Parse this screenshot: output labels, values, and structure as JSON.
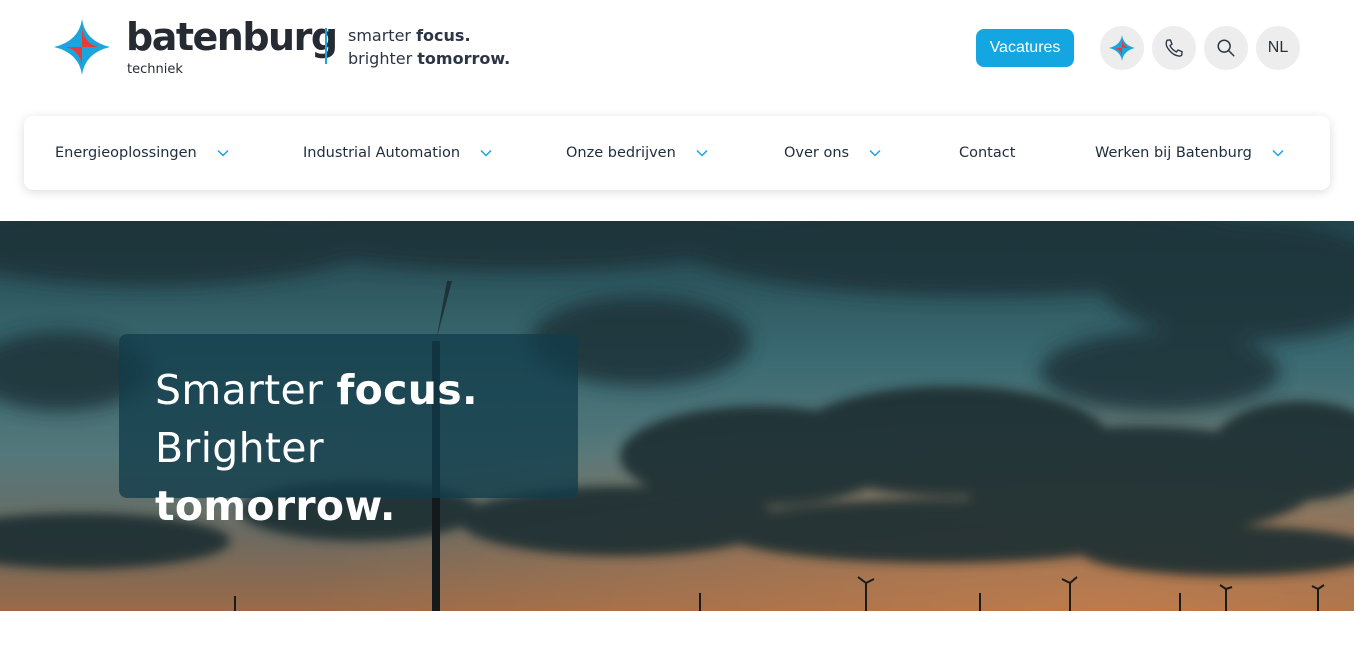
{
  "brand": {
    "name": "batenburg",
    "sub": "techniek",
    "tagline_line1_a": "smarter ",
    "tagline_line1_b": "focus.",
    "tagline_line2_a": "brighter ",
    "tagline_line2_b": "tomorrow.",
    "colors": {
      "blue": "#1aa6dc",
      "red": "#e63b3b",
      "dark": "#262b33"
    }
  },
  "header": {
    "vacatures_label": "Vacatures",
    "language_label": "NL",
    "icons": [
      "batenburg-star-icon",
      "phone-icon",
      "search-icon"
    ]
  },
  "nav": {
    "items": [
      {
        "label": "Energieoplossingen",
        "has_dropdown": true
      },
      {
        "label": "Industrial Automation",
        "has_dropdown": true
      },
      {
        "label": "Onze bedrijven",
        "has_dropdown": true
      },
      {
        "label": "Over ons",
        "has_dropdown": true
      },
      {
        "label": "Contact",
        "has_dropdown": false
      },
      {
        "label": "Werken bij Batenburg",
        "has_dropdown": true
      }
    ],
    "chevron_icon": "chevron-down-icon",
    "chevron_color": "#1aa6dc"
  },
  "hero": {
    "line1_a": "Smarter ",
    "line1_b": "focus.",
    "line2_a": "Brighter ",
    "line2_b": "tomorrow."
  }
}
